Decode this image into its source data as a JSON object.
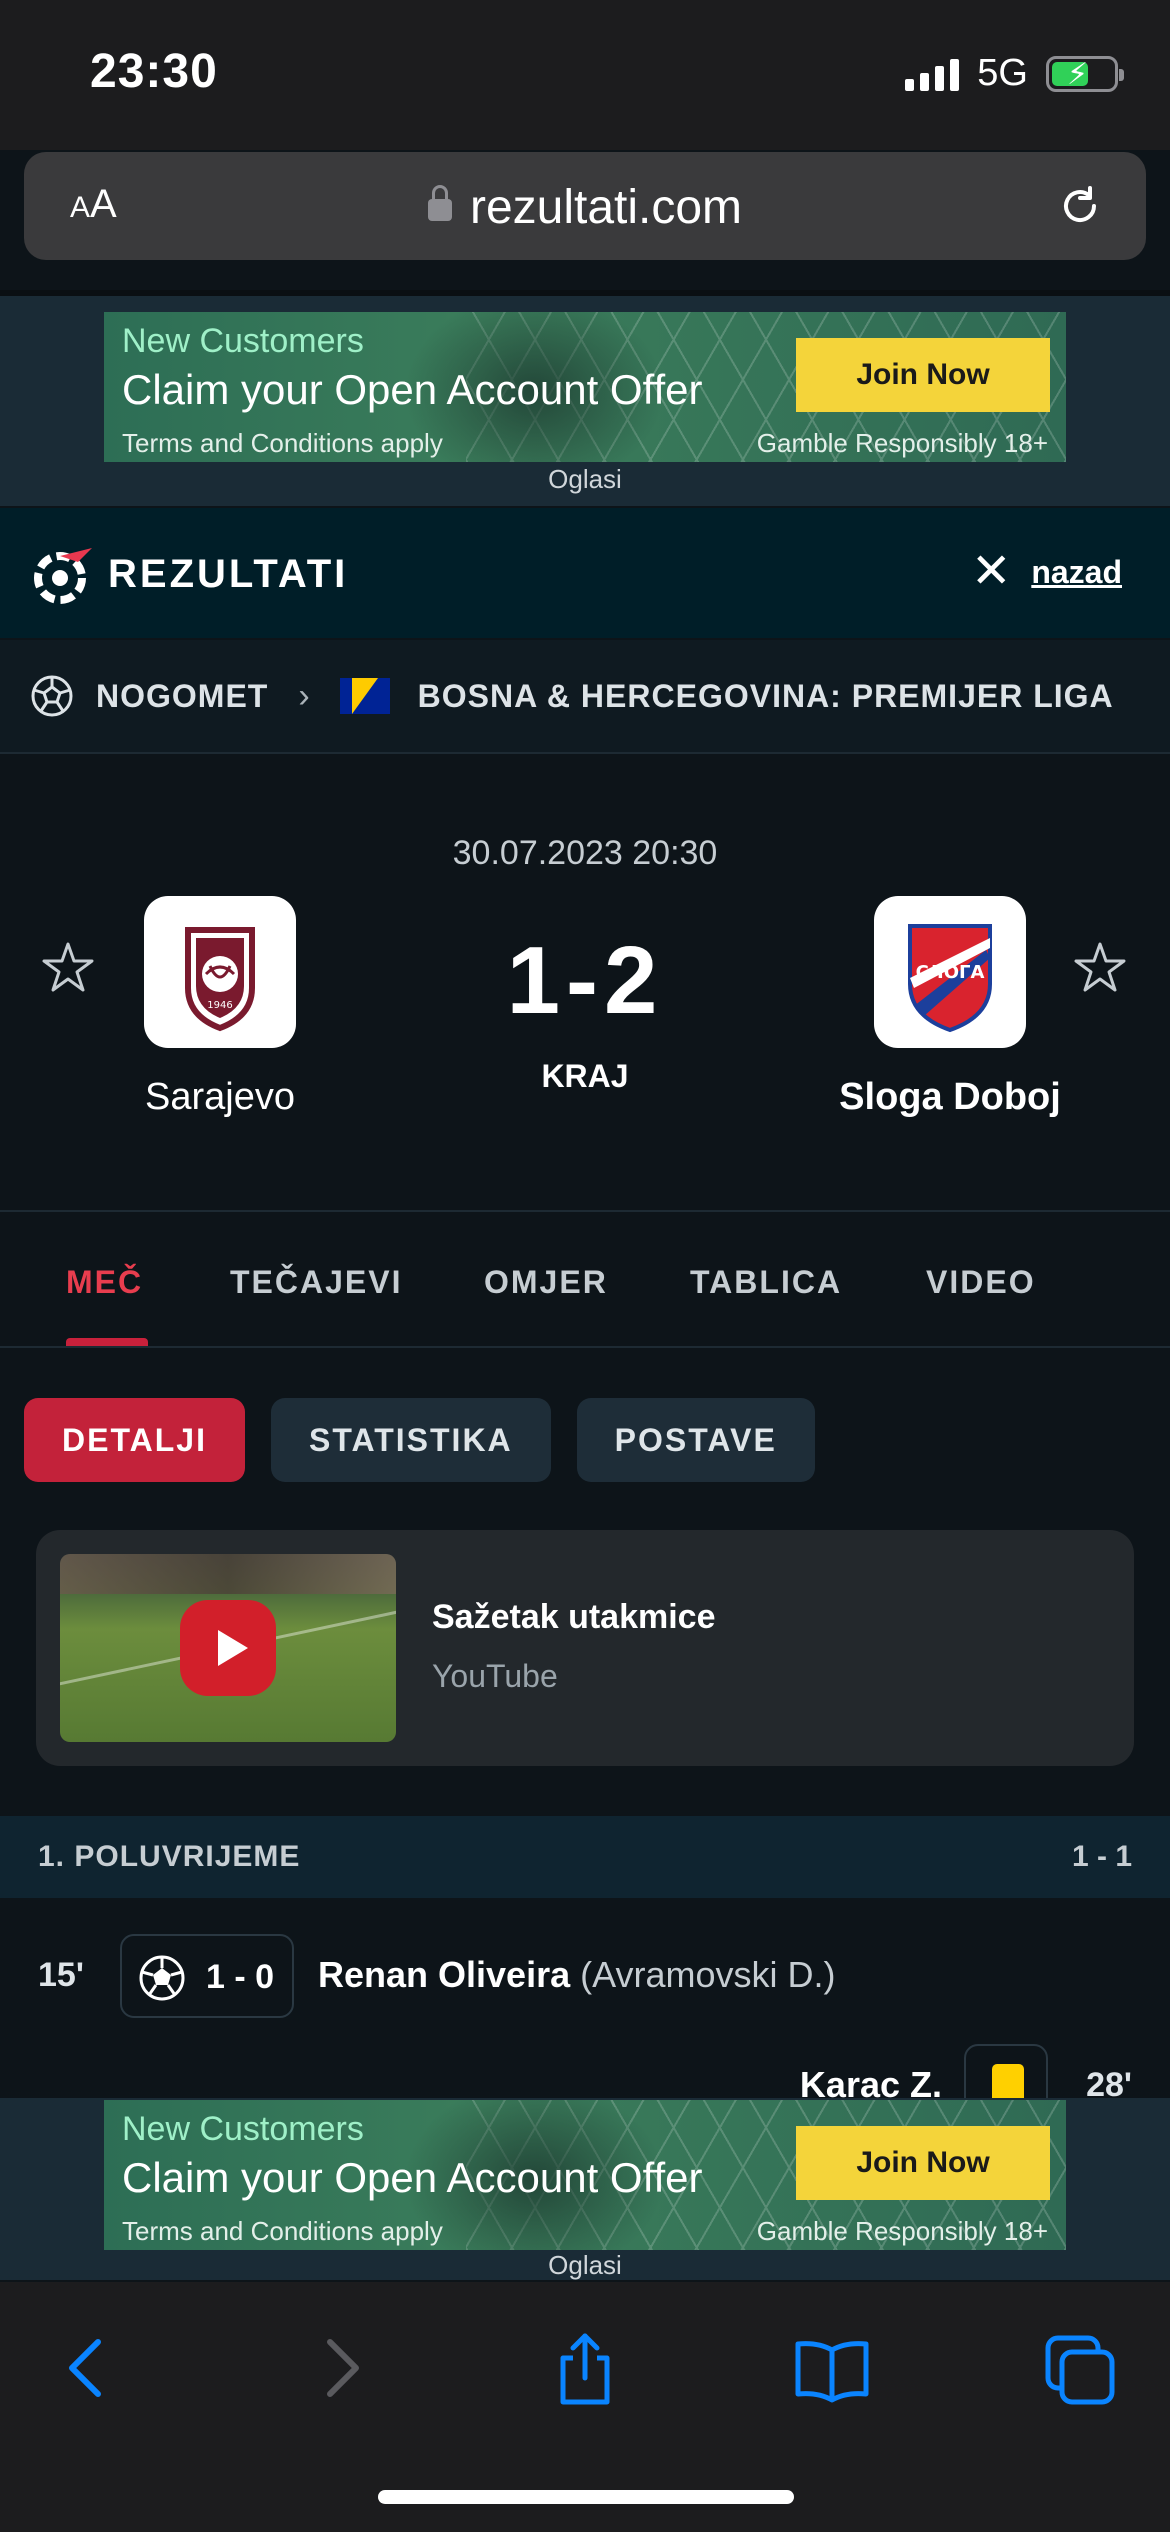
{
  "status_bar": {
    "time": "23:30",
    "network": "5G"
  },
  "url_bar": {
    "aa_small": "A",
    "aa_big": "A",
    "url": "rezultati.com"
  },
  "ad": {
    "line1": "New Customers",
    "line2": "Claim your Open Account Offer",
    "terms": "Terms and Conditions apply",
    "gamble": "Gamble Responsibly 18+",
    "cta": "Join Now",
    "label": "Oglasi"
  },
  "header": {
    "logo_text": "REZULTATI",
    "back_label": "nazad"
  },
  "breadcrumb": {
    "sport": "NOGOMET",
    "league": "BOSNA & HERCEGOVINA: PREMIJER LIGA"
  },
  "match": {
    "date": "30.07.2023 20:30",
    "home": "Sarajevo",
    "away": "Sloga Doboj",
    "score": "1-2",
    "status": "KRAJ"
  },
  "tabs": [
    "MEČ",
    "TEČAJEVI",
    "OMJER",
    "TABLICA",
    "VIDEO"
  ],
  "subtabs": [
    "DETALJI",
    "STATISTIKA",
    "POSTAVE"
  ],
  "video": {
    "title": "Sažetak utakmice",
    "source": "YouTube"
  },
  "half": {
    "label": "1. POLUVRIJEME",
    "score": "1 - 1"
  },
  "events": [
    {
      "minute": "15'",
      "score": "1 - 0",
      "player": "Renan Oliveira",
      "assist": "(Avramovski D.)"
    },
    {
      "minute": "28'",
      "player": "Karac Z."
    }
  ],
  "colors": {
    "accent": "#c3223a",
    "brand_bg": "#001e28",
    "yellow_card": "#ffd000"
  }
}
